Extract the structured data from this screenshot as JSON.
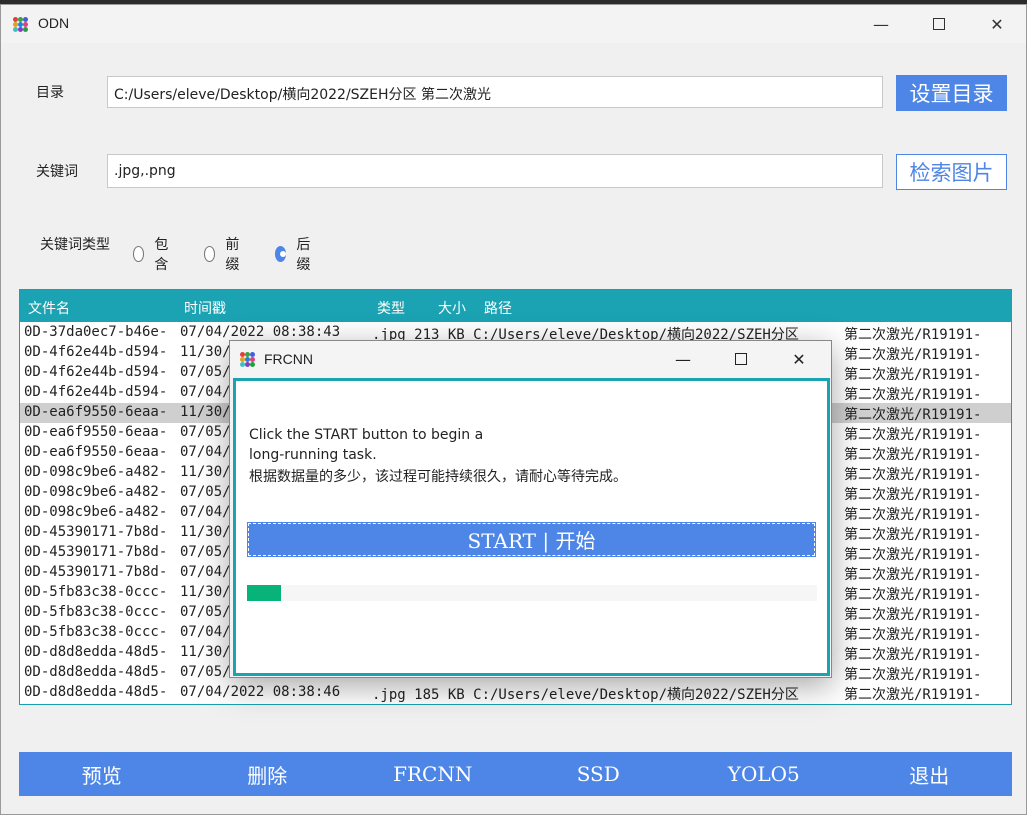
{
  "app": {
    "title": "ODN"
  },
  "form": {
    "dir_label": "目录",
    "dir_value": "C:/Users/eleve/Desktop/横向2022/SZEH分区 第二次激光",
    "set_dir_button": "设置目录",
    "keyword_label": "关键词",
    "keyword_value": ".jpg,.png",
    "search_button": "检索图片",
    "keyword_type_label": "关键词类型",
    "keyword_type_options": [
      "包含",
      "前缀",
      "后缀"
    ],
    "keyword_type_selected": "后缀"
  },
  "table": {
    "headers": [
      "文件名",
      "时间戳",
      "类型",
      "大小",
      "路径"
    ],
    "rows": [
      [
        "0D-37da0ec7-b46e-",
        "07/04/2022 08:38:43",
        ".jpg 213 KB C:/Users/eleve/Desktop/横向2022/SZEH分区",
        "第二次激光/R19191-"
      ],
      [
        "0D-4f62e44b-d594-",
        "11/30/",
        "",
        "第二次激光/R19191-"
      ],
      [
        "0D-4f62e44b-d594-",
        "07/05/",
        "",
        "第二次激光/R19191-"
      ],
      [
        "0D-4f62e44b-d594-",
        "07/04/",
        "",
        "第二次激光/R19191-"
      ],
      [
        "0D-ea6f9550-6eaa-",
        "11/30/",
        "",
        "第二次激光/R19191-"
      ],
      [
        "0D-ea6f9550-6eaa-",
        "07/05/",
        "",
        "第二次激光/R19191-"
      ],
      [
        "0D-ea6f9550-6eaa-",
        "07/04/",
        "",
        "第二次激光/R19191-"
      ],
      [
        "0D-098c9be6-a482-",
        "11/30/",
        "",
        "第二次激光/R19191-"
      ],
      [
        "0D-098c9be6-a482-",
        "07/05/",
        "",
        "第二次激光/R19191-"
      ],
      [
        "0D-098c9be6-a482-",
        "07/04/",
        "",
        "第二次激光/R19191-"
      ],
      [
        "0D-45390171-7b8d-",
        "11/30/",
        "",
        "第二次激光/R19191-"
      ],
      [
        "0D-45390171-7b8d-",
        "07/05/",
        "",
        "第二次激光/R19191-"
      ],
      [
        "0D-45390171-7b8d-",
        "07/04/",
        "",
        "第二次激光/R19191-"
      ],
      [
        "0D-5fb83c38-0ccc-",
        "11/30/",
        "",
        "第二次激光/R19191-"
      ],
      [
        "0D-5fb83c38-0ccc-",
        "07/05/",
        "",
        "第二次激光/R19191-"
      ],
      [
        "0D-5fb83c38-0ccc-",
        "07/04/",
        "",
        "第二次激光/R19191-"
      ],
      [
        "0D-d8d8edda-48d5-",
        "11/30/",
        "",
        "第二次激光/R19191-"
      ],
      [
        "0D-d8d8edda-48d5-",
        "07/05/",
        "",
        "第二次激光/R19191-"
      ],
      [
        "0D-d8d8edda-48d5-",
        "07/04/2022 08:38:46",
        ".jpg 185 KB C:/Users/eleve/Desktop/横向2022/SZEH分区",
        "第二次激光/R19191-"
      ]
    ],
    "selected_row": 4
  },
  "toolbar": [
    "预览",
    "删除",
    "FRCNN",
    "SSD",
    "YOLO5",
    "退出"
  ],
  "dialog": {
    "title": "FRCNN",
    "line1": "Click the START button to begin a",
    "line2": "long-running task.",
    "line3": "根据数据量的多少，该过程可能持续很久，请耐心等待完成。",
    "start_button": "START | 开始",
    "progress": 0.06
  },
  "colors": {
    "accent": "#4d86e6",
    "teal": "#1ba3b3",
    "progress": "#08b37a"
  }
}
